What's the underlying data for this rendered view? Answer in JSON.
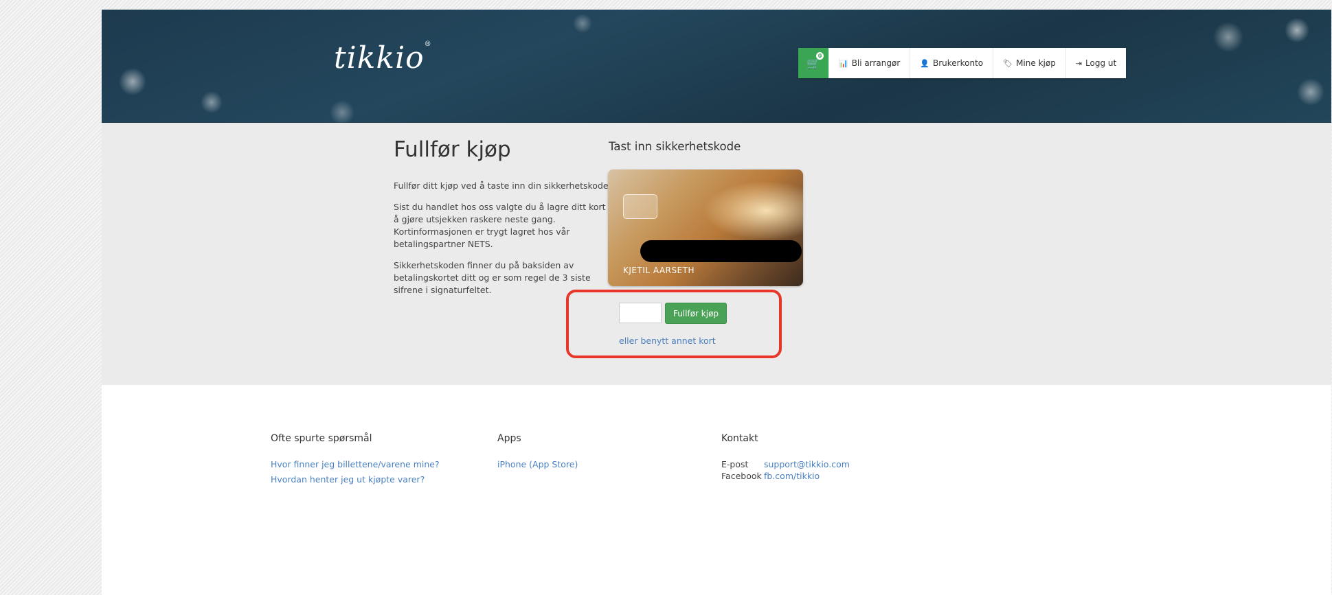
{
  "header": {
    "logo": "tikkio",
    "logo_mark": "®",
    "cart_count": "0",
    "nav": [
      {
        "icon": "bar-chart-icon",
        "glyph": "📊",
        "label": "Bli arrangør"
      },
      {
        "icon": "user-icon",
        "glyph": "👤",
        "label": "Brukerkonto"
      },
      {
        "icon": "tag-icon",
        "glyph": "🏷",
        "label": "Mine kjøp"
      },
      {
        "icon": "logout-icon",
        "glyph": "⇥",
        "label": "Logg ut"
      }
    ]
  },
  "main": {
    "title": "Fullfør kjøp",
    "paragraphs": [
      "Fullfør ditt kjøp ved å taste inn din sikkerhetskode.",
      "Sist du handlet hos oss valgte du å lagre ditt kort for å gjøre utsjekken raskere neste gang. Kortinformasjonen er trygt lagret hos vår betalingspartner NETS.",
      "Sikkerhetskoden finner du på baksiden av betalingskortet ditt og er som regel de 3 siste sifrene i signaturfeltet."
    ],
    "security_title": "Tast inn sikkerhetskode",
    "cardholder": "KJETIL AARSETH",
    "code_value": "",
    "submit_label": "Fullfør kjøp",
    "alt_link": "eller benytt annet kort"
  },
  "footer": {
    "faq": {
      "title": "Ofte spurte spørsmål",
      "links": [
        "Hvor finner jeg billettene/varene mine?",
        "Hvordan henter jeg ut kjøpte varer?"
      ]
    },
    "apps": {
      "title": "Apps",
      "links": [
        "iPhone (App Store)"
      ]
    },
    "contact": {
      "title": "Kontakt",
      "email_label": "E-post",
      "email": "support@tikkio.com",
      "facebook_label": "Facebook",
      "facebook": "fb.com/tikkio"
    }
  },
  "colors": {
    "header_bg": "#1d3a4e",
    "accent_green": "#3aa654",
    "highlight_red": "#e9362b",
    "link_blue": "#4a80c0"
  }
}
